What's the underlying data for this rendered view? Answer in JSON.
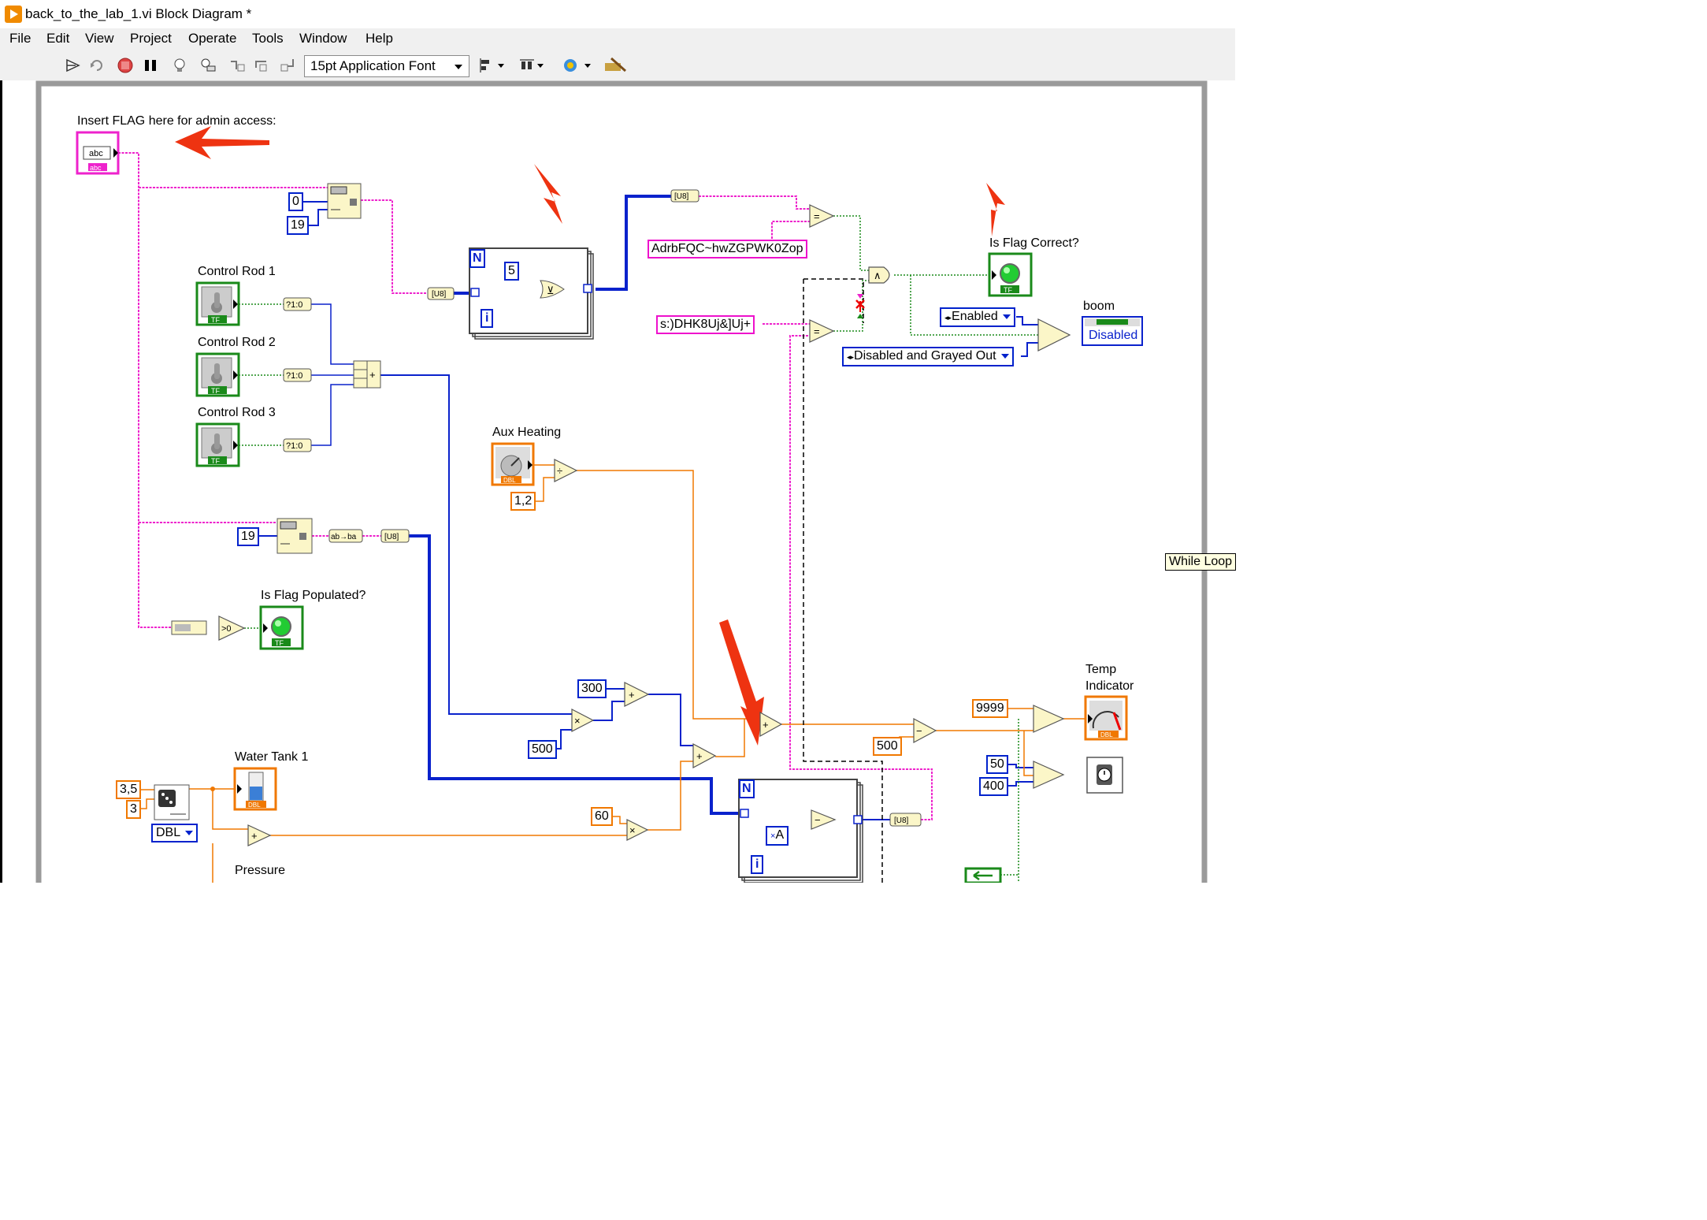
{
  "window": {
    "title": "back_to_the_lab_1.vi Block Diagram *"
  },
  "menu": [
    "File",
    "Edit",
    "View",
    "Project",
    "Operate",
    "Tools",
    "Window",
    "Help"
  ],
  "toolbar": {
    "font": "15pt Application Font",
    "buttons": [
      "run-continuously-icon",
      "run-icon",
      "abort-icon",
      "pause-icon",
      "highlight-execution-icon",
      "retain-wire-values-icon",
      "step-into-icon",
      "step-over-icon",
      "step-out-icon",
      "align-objects-icon",
      "distribute-objects-icon",
      "reorder-icon",
      "cleanup-diagram-icon"
    ]
  },
  "labels": {
    "insert_flag": "Insert FLAG here for admin access:",
    "control_rod_1": "Control Rod 1",
    "control_rod_2": "Control Rod 2",
    "control_rod_3": "Control Rod 3",
    "aux_heating": "Aux Heating",
    "is_flag_populated": "Is Flag Populated?",
    "is_flag_correct": "Is Flag Correct?",
    "boom": "boom",
    "water_tank": "Water Tank 1",
    "pressure": "Pressure",
    "temp_indicator_1": "Temp",
    "temp_indicator_2": "Indicator"
  },
  "constants": {
    "c0": "0",
    "c19a": "19",
    "c19b": "19",
    "c5": "5",
    "str1": "AdrbFQC~hwZGPWK0Zop",
    "str2": "s:)DHK8Uj&]Uj+",
    "c12": "1,2",
    "c300": "300",
    "c500a": "500",
    "c500b": "500",
    "c9999": "9999",
    "c50": "50",
    "c400": "400",
    "c60": "60",
    "c35": "3,5",
    "c3": "3",
    "dbl": "DBL",
    "xA": "A",
    "N": "N",
    "i": "i",
    "boom_value": "Disabled"
  },
  "enums": {
    "enabled": "Enabled",
    "disabled_grayed": "Disabled and Grayed Out"
  },
  "node_glyphs": {
    "bool_to_num": "?1:0",
    "gt_zero": ">0",
    "reverse": "ab→ba",
    "u8": "[U8]",
    "add": "+",
    "sub": "−",
    "mul": "×",
    "div": "÷",
    "and": "∧",
    "eq": "=",
    "xor": "⊻",
    "abc": "abc",
    "tf": "TF",
    "dbl_tag": "DBL"
  },
  "tooltip": "While Loop"
}
